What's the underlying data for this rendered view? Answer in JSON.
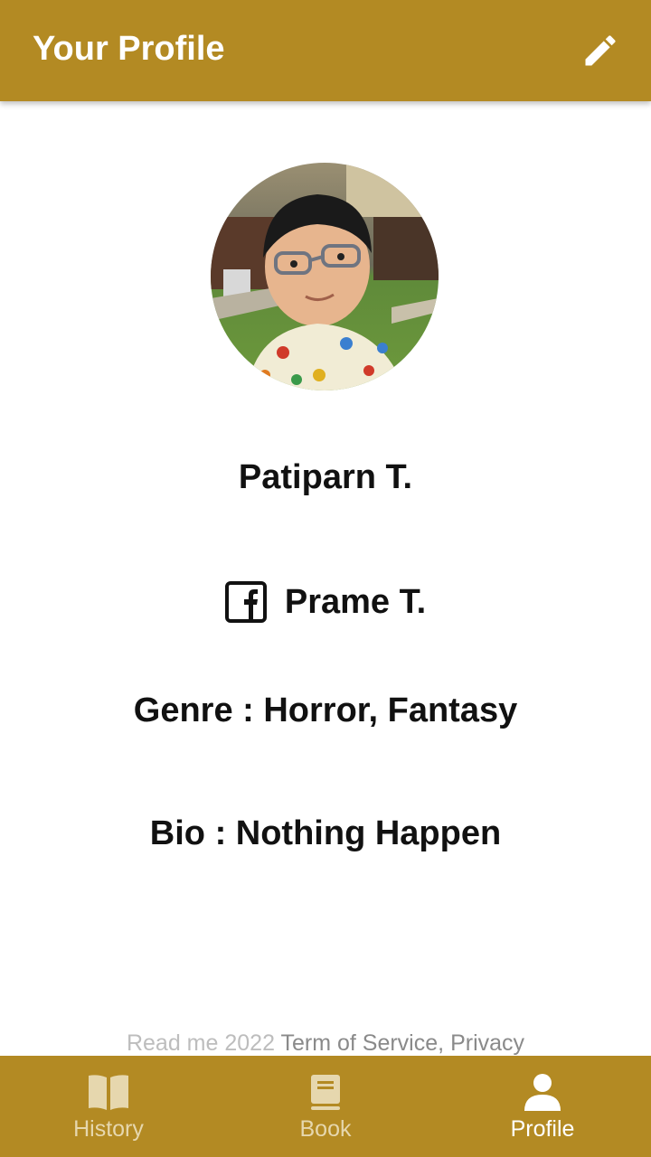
{
  "appbar": {
    "title": "Your Profile",
    "edit_icon": "pencil-icon"
  },
  "colors": {
    "primary": "#b38a23",
    "nav_inactive": "#e6d7ae",
    "nav_active": "#ffffff",
    "text": "#111111"
  },
  "profile": {
    "name": "Patiparn T.",
    "facebook_icon": "facebook-icon",
    "facebook_name": "Prame T.",
    "genre": "Genre : Horror, Fantasy",
    "bio": "Bio : Nothing Happen"
  },
  "footer": {
    "copyright": "Read me 2022",
    "terms": "Term of Service",
    "separator": ",",
    "privacy": "Privacy"
  },
  "bottom_nav": {
    "items": [
      {
        "label": "History",
        "icon": "open-book-icon",
        "active": false
      },
      {
        "label": "Book",
        "icon": "book-icon",
        "active": false
      },
      {
        "label": "Profile",
        "icon": "person-icon",
        "active": true
      }
    ]
  }
}
